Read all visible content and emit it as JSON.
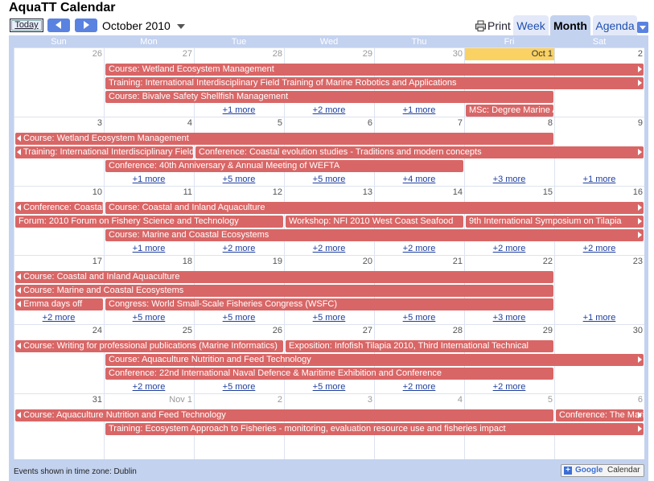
{
  "app_title": "AquaTT Calendar",
  "nav": {
    "today_label": "Today",
    "month_label": "October 2010",
    "print_label": "Print"
  },
  "tabs": {
    "week": "Week",
    "month": "Month",
    "agenda": "Agenda"
  },
  "days_of_week": [
    "Sun",
    "Mon",
    "Tue",
    "Wed",
    "Thu",
    "Fri",
    "Sat"
  ],
  "weeks": [
    {
      "dates": [
        "26",
        "27",
        "28",
        "29",
        "30",
        "Oct 1",
        "2"
      ],
      "grey": [
        0,
        1,
        2,
        3,
        4
      ],
      "today": 5,
      "events": [
        {
          "row": 0,
          "start": 1,
          "end": 7,
          "title": "Course: Wetland Ecosystem Management",
          "cont_left": false,
          "cont_right": true
        },
        {
          "row": 1,
          "start": 1,
          "end": 7,
          "title": "Training: International Interdisciplinary Field Training of Marine Robotics and Applications",
          "cont_left": false,
          "cont_right": true
        },
        {
          "row": 2,
          "start": 1,
          "end": 6,
          "title": "Course: Bivalve Safety Shellfish Management",
          "cont_left": false,
          "cont_right": false
        },
        {
          "row": 3,
          "start": 5,
          "end": 6,
          "title": "MSc: Degree Marine Aquaculture",
          "cont_left": false,
          "cont_right": false
        }
      ],
      "more": [
        {
          "row": 3,
          "col": 2,
          "text": "+1 more"
        },
        {
          "row": 3,
          "col": 3,
          "text": "+2 more"
        },
        {
          "row": 3,
          "col": 4,
          "text": "+1 more"
        }
      ]
    },
    {
      "dates": [
        "3",
        "4",
        "5",
        "6",
        "7",
        "8",
        "9"
      ],
      "grey": [],
      "events": [
        {
          "row": 0,
          "start": 0,
          "end": 6,
          "title": "Course: Wetland Ecosystem Management",
          "cont_left": true,
          "cont_right": false
        },
        {
          "row": 1,
          "start": 0,
          "end": 2,
          "title": "Training: International Interdisciplinary Field Training",
          "cont_left": true,
          "cont_right": false
        },
        {
          "row": 1,
          "start": 2,
          "end": 7,
          "title": "Conference: Coastal evolution studies - Traditions and modern concepts",
          "cont_left": false,
          "cont_right": true
        },
        {
          "row": 2,
          "start": 1,
          "end": 5,
          "title": "Conference: 40th Anniversary & Annual Meeting of WEFTA",
          "cont_left": false,
          "cont_right": false
        }
      ],
      "more": [
        {
          "row": 3,
          "col": 1,
          "text": "+1 more"
        },
        {
          "row": 3,
          "col": 2,
          "text": "+5 more"
        },
        {
          "row": 3,
          "col": 3,
          "text": "+5 more"
        },
        {
          "row": 3,
          "col": 4,
          "text": "+4 more"
        },
        {
          "row": 3,
          "col": 5,
          "text": "+3 more"
        },
        {
          "row": 3,
          "col": 6,
          "text": "+1 more"
        }
      ]
    },
    {
      "dates": [
        "10",
        "11",
        "12",
        "13",
        "14",
        "15",
        "16"
      ],
      "grey": [],
      "events": [
        {
          "row": 0,
          "start": 0,
          "end": 1,
          "title": "Conference: Coastal evolution studies",
          "cont_left": true,
          "cont_right": false
        },
        {
          "row": 0,
          "start": 1,
          "end": 7,
          "title": "Course: Coastal and Inland Aquaculture",
          "cont_left": false,
          "cont_right": true
        },
        {
          "row": 1,
          "start": 0,
          "end": 3,
          "title": "Forum: 2010 Forum on Fishery Science and Technology",
          "cont_left": false,
          "cont_right": false
        },
        {
          "row": 1,
          "start": 3,
          "end": 5,
          "title": "Workshop: NFI 2010 West Coast Seafood",
          "cont_left": false,
          "cont_right": false
        },
        {
          "row": 1,
          "start": 5,
          "end": 7,
          "title": "9th International Symposium on Tilapia",
          "cont_left": false,
          "cont_right": true
        },
        {
          "row": 2,
          "start": 1,
          "end": 7,
          "title": "Course: Marine and Coastal Ecosystems",
          "cont_left": false,
          "cont_right": true
        }
      ],
      "more": [
        {
          "row": 3,
          "col": 1,
          "text": "+1 more"
        },
        {
          "row": 3,
          "col": 2,
          "text": "+2 more"
        },
        {
          "row": 3,
          "col": 3,
          "text": "+2 more"
        },
        {
          "row": 3,
          "col": 4,
          "text": "+2 more"
        },
        {
          "row": 3,
          "col": 5,
          "text": "+2 more"
        },
        {
          "row": 3,
          "col": 6,
          "text": "+2 more"
        }
      ]
    },
    {
      "dates": [
        "17",
        "18",
        "19",
        "20",
        "21",
        "22",
        "23"
      ],
      "grey": [],
      "events": [
        {
          "row": 0,
          "start": 0,
          "end": 6,
          "title": "Course: Coastal and Inland Aquaculture",
          "cont_left": true,
          "cont_right": false
        },
        {
          "row": 1,
          "start": 0,
          "end": 6,
          "title": "Course: Marine and Coastal Ecosystems",
          "cont_left": true,
          "cont_right": false
        },
        {
          "row": 2,
          "start": 0,
          "end": 1,
          "title": "Emma days off",
          "cont_left": true,
          "cont_right": false
        },
        {
          "row": 2,
          "start": 1,
          "end": 6,
          "title": "Congress: World Small-Scale Fisheries Congress (WSFC)",
          "cont_left": false,
          "cont_right": false
        }
      ],
      "more": [
        {
          "row": 3,
          "col": 0,
          "text": "+2 more"
        },
        {
          "row": 3,
          "col": 1,
          "text": "+5 more"
        },
        {
          "row": 3,
          "col": 2,
          "text": "+5 more"
        },
        {
          "row": 3,
          "col": 3,
          "text": "+5 more"
        },
        {
          "row": 3,
          "col": 4,
          "text": "+5 more"
        },
        {
          "row": 3,
          "col": 5,
          "text": "+3 more"
        },
        {
          "row": 3,
          "col": 6,
          "text": "+1 more"
        }
      ]
    },
    {
      "dates": [
        "24",
        "25",
        "26",
        "27",
        "28",
        "29",
        "30"
      ],
      "grey": [],
      "events": [
        {
          "row": 0,
          "start": 0,
          "end": 3,
          "title": "Course: Writing for professional publications (Marine Informatics)",
          "cont_left": true,
          "cont_right": false
        },
        {
          "row": 0,
          "start": 3,
          "end": 6,
          "title": "Exposition: Infofish Tilapia 2010, Third International Technical",
          "cont_left": false,
          "cont_right": false
        },
        {
          "row": 1,
          "start": 1,
          "end": 7,
          "title": "Course: Aquaculture Nutrition and Feed Technology",
          "cont_left": false,
          "cont_right": true
        },
        {
          "row": 2,
          "start": 1,
          "end": 6,
          "title": "Conference: 22nd International Naval Defence & Maritime Exhibition and Conference",
          "cont_left": false,
          "cont_right": false
        }
      ],
      "more": [
        {
          "row": 3,
          "col": 1,
          "text": "+2 more"
        },
        {
          "row": 3,
          "col": 2,
          "text": "+5 more"
        },
        {
          "row": 3,
          "col": 3,
          "text": "+5 more"
        },
        {
          "row": 3,
          "col": 4,
          "text": "+2 more"
        },
        {
          "row": 3,
          "col": 5,
          "text": "+2 more"
        }
      ]
    },
    {
      "dates": [
        "31",
        "Nov 1",
        "2",
        "3",
        "4",
        "5",
        "6"
      ],
      "grey": [
        1,
        2,
        3,
        4,
        5,
        6
      ],
      "events": [
        {
          "row": 0,
          "start": 0,
          "end": 6,
          "title": "Course: Aquaculture Nutrition and Feed Technology",
          "cont_left": true,
          "cont_right": false
        },
        {
          "row": 0,
          "start": 6,
          "end": 7,
          "title": "Conference: The Marine",
          "cont_left": false,
          "cont_right": true
        },
        {
          "row": 1,
          "start": 1,
          "end": 7,
          "title": "Training: Ecosystem Approach to Fisheries - monitoring, evaluation resource use and fisheries impact",
          "cont_left": false,
          "cont_right": true
        }
      ],
      "more": []
    }
  ],
  "footer": {
    "timezone_text": "Events shown in time zone: Dublin",
    "badge_google": "Google",
    "badge_calendar": "Calendar"
  },
  "colors": {
    "event": "#d96666",
    "today": "#fad163",
    "frame": "#c3d2ef",
    "accent": "#5a82e0"
  }
}
